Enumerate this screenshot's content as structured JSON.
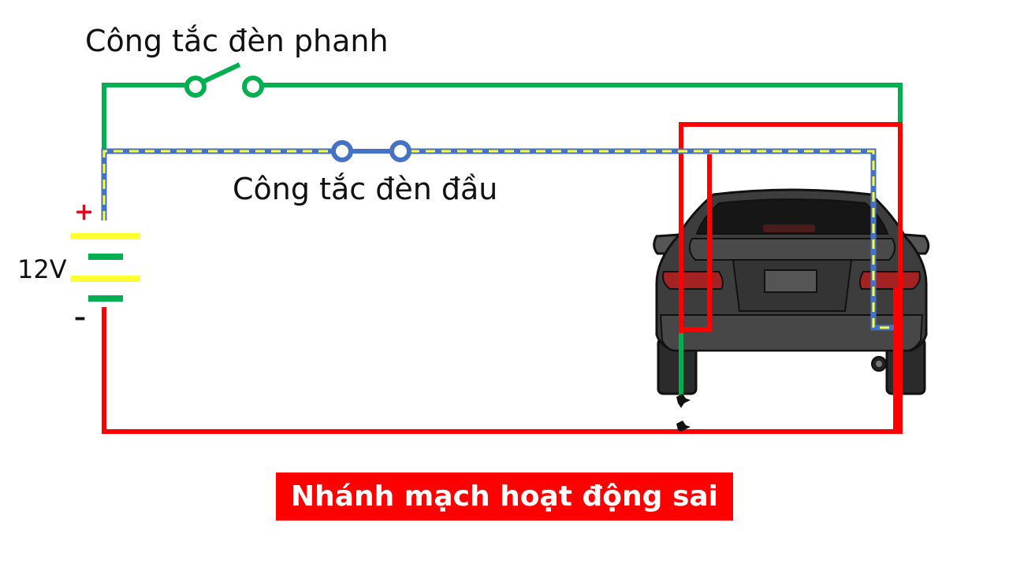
{
  "labels": {
    "brake_switch": "Công tắc đèn phanh",
    "headlight_switch": "Công tắc đèn đầu",
    "battery_voltage": "12V",
    "positive": "+",
    "negative": "–"
  },
  "status": {
    "text": "Nhánh mạch hoạt động sai"
  },
  "colors": {
    "brake_circuit": "#00b050",
    "headlight_dash": "#ffff33",
    "headlight_wire": "#4472c4",
    "faulty_branch": "#ff0000",
    "car_body": "#3d3d3d",
    "tail_lamp": "#a32222"
  },
  "icons": [
    "switch-open-icon",
    "switch-terminal-icon",
    "battery-icon",
    "car-rear-icon"
  ]
}
